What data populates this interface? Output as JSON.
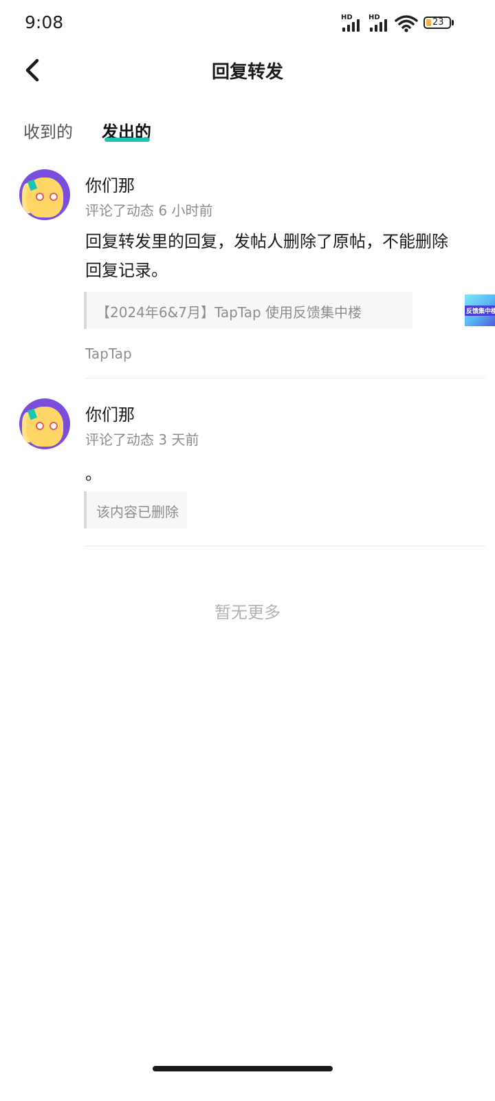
{
  "status_bar": {
    "time": "9:08",
    "signal1_label": "HD",
    "signal2_label": "HD",
    "battery_level": "23"
  },
  "header": {
    "title": "回复转发",
    "back_icon": "chevron-left-icon"
  },
  "tabs": [
    {
      "label": "收到的",
      "active": false
    },
    {
      "label": "发出的",
      "active": true
    }
  ],
  "accent_color": "#19c3b4",
  "items": [
    {
      "name": "你们那",
      "meta": "评论了动态 6 小时前",
      "content": "回复转发里的回复，发帖人删除了原帖，不能删除回复记录。",
      "quote": "【2024年6&7月】TapTap 使用反馈集中楼",
      "thumbnail_text": "反馈集中楼",
      "source": "TapTap"
    },
    {
      "name": "你们那",
      "meta": "评论了动态 3 天前",
      "content": "。",
      "quote": "该内容已删除"
    }
  ],
  "footer": {
    "no_more": "暂无更多"
  }
}
